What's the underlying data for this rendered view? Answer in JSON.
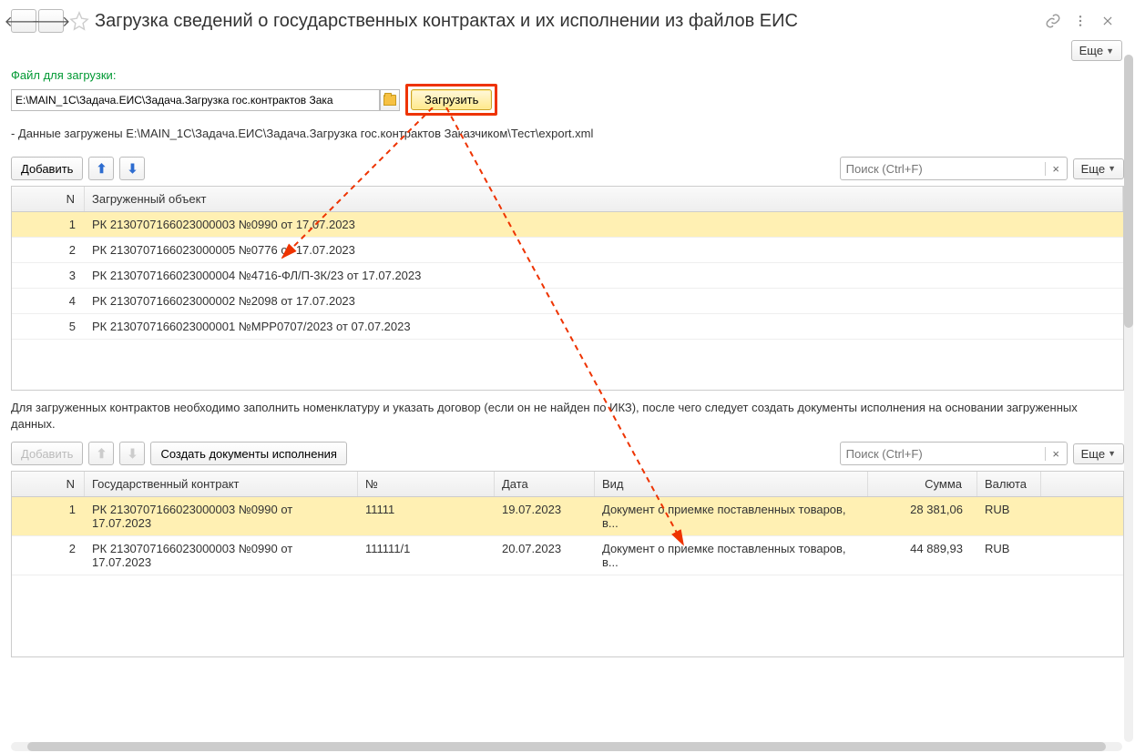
{
  "header": {
    "title": "Загрузка сведений о государственных контрактах и их исполнении из файлов ЕИС"
  },
  "more_label": "Еще",
  "file": {
    "label": "Файл для загрузки:",
    "value": "E:\\MAIN_1C\\Задача.ЕИС\\Задача.Загрузка гос.контрактов Зака",
    "load_button": "Загрузить"
  },
  "status_text": "- Данные загружены  E:\\MAIN_1C\\Задача.ЕИС\\Задача.Загрузка гос.контрактов Заказчиком\\Тест\\export.xml",
  "table1": {
    "toolbar": {
      "add": "Добавить"
    },
    "search_placeholder": "Поиск (Ctrl+F)",
    "headers": {
      "n": "N",
      "obj": "Загруженный объект"
    },
    "rows": [
      {
        "n": "1",
        "obj": "РК 2130707166023000003 №0990 от 17.07.2023",
        "selected": true
      },
      {
        "n": "2",
        "obj": "РК 2130707166023000005 №0776 от 17.07.2023"
      },
      {
        "n": "3",
        "obj": "РК 2130707166023000004 №4716-ФЛ/П-3К/23 от 17.07.2023"
      },
      {
        "n": "4",
        "obj": "РК 2130707166023000002 №2098 от 17.07.2023"
      },
      {
        "n": "5",
        "obj": "РК 2130707166023000001 №МРР0707/2023 от 07.07.2023"
      }
    ]
  },
  "info_text": "Для загруженных контрактов необходимо заполнить номенклатуру и указать договор (если он не найден по ИКЗ), после чего следует создать документы исполнения на основании загруженных данных.",
  "table2": {
    "toolbar": {
      "add": "Добавить",
      "create_docs": "Создать документы исполнения"
    },
    "search_placeholder": "Поиск (Ctrl+F)",
    "headers": {
      "n": "N",
      "gk": "Государственный контракт",
      "no": "№",
      "date": "Дата",
      "kind": "Вид",
      "sum": "Сумма",
      "cur": "Валюта"
    },
    "rows": [
      {
        "n": "1",
        "gk": "РК 2130707166023000003 №0990 от 17.07.2023",
        "no": "11111",
        "date": "19.07.2023",
        "kind": "Документ о приемке поставленных товаров, в...",
        "sum": "28 381,06",
        "cur": "RUB",
        "selected": true
      },
      {
        "n": "2",
        "gk": "РК 2130707166023000003 №0990 от 17.07.2023",
        "no": "111111/1",
        "date": "20.07.2023",
        "kind": "Документ о приемке поставленных товаров, в...",
        "sum": "44 889,93",
        "cur": "RUB"
      }
    ]
  }
}
